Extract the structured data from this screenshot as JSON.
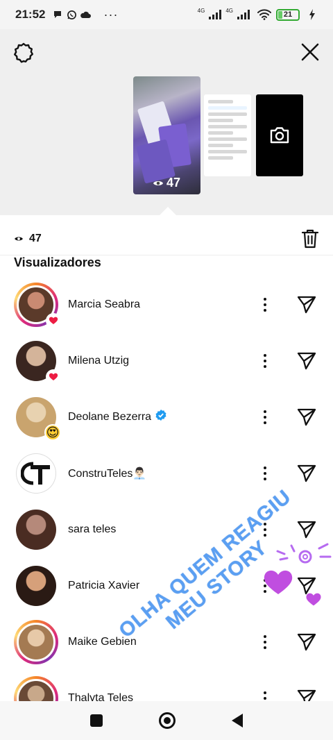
{
  "status_bar": {
    "time": "21:52",
    "network1": "4G",
    "network2": "4G",
    "battery": "21"
  },
  "story": {
    "views": "47"
  },
  "views_row": {
    "count": "47"
  },
  "section_title": "Visualizadores",
  "viewers": [
    {
      "name": "Marcia Seabra",
      "reaction": "heart",
      "ring": true,
      "verified": false,
      "colors": [
        "#c98a72",
        "#5b3a2a"
      ]
    },
    {
      "name": "Milena Utzig",
      "reaction": "heart",
      "ring": false,
      "verified": false,
      "colors": [
        "#d4b49a",
        "#3a2620"
      ]
    },
    {
      "name": "Deolane Bezerra",
      "reaction": "😍",
      "ring": false,
      "verified": true,
      "colors": [
        "#e8d2b0",
        "#c9a46e"
      ]
    },
    {
      "name": "ConstruTeles👨🏻‍💼",
      "reaction": "",
      "ring": false,
      "verified": false,
      "colors": [
        "#ffffff",
        "#111111"
      ]
    },
    {
      "name": "sara teles",
      "reaction": "",
      "ring": false,
      "verified": false,
      "colors": [
        "#b5897a",
        "#4a2c22"
      ]
    },
    {
      "name": "Patricia Xavier",
      "reaction": "",
      "ring": false,
      "verified": false,
      "colors": [
        "#d6a07a",
        "#2a1a14"
      ]
    },
    {
      "name": "Maike Gebien",
      "reaction": "",
      "ring": true,
      "verified": false,
      "colors": [
        "#e7c9a8",
        "#a47a52"
      ]
    },
    {
      "name": "Thalyta Teles",
      "reaction": "",
      "ring": true,
      "verified": false,
      "colors": [
        "#c8a88a",
        "#6a4a36"
      ]
    }
  ],
  "sticker": {
    "line1": "OLHA QUEM REAGIU",
    "line2": "MEU STORY"
  },
  "colors": {
    "accent_ring": "#dd2a7b",
    "heart": "#ed1c43",
    "verified": "#1f9bf0",
    "sticker": "#5b9ff2"
  }
}
